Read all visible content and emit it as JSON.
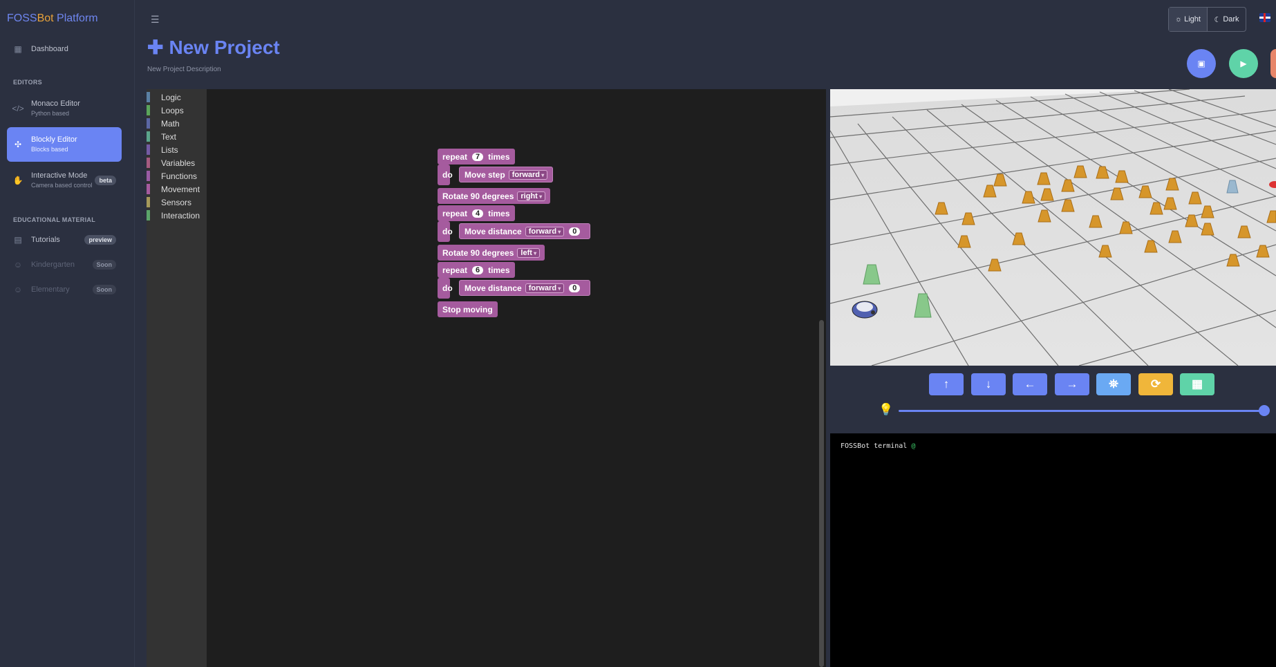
{
  "brand": {
    "part1": "FOSS",
    "part2": "Bot",
    "part3": " Platform"
  },
  "sidebar": {
    "dashboard": "Dashboard",
    "section_editors": "EDITORS",
    "editors": [
      {
        "label": "Monaco Editor",
        "sub": "Python based"
      },
      {
        "label": "Blockly Editor",
        "sub": "Blocks based"
      },
      {
        "label": "Interactive Mode",
        "sub": "Camera based control",
        "badge": "beta"
      }
    ],
    "section_edu": "EDUCATIONAL MATERIAL",
    "edu": [
      {
        "label": "Tutorials",
        "badge": "preview"
      },
      {
        "label": "Kindergarten",
        "badge": "Soon"
      },
      {
        "label": "Elementary",
        "badge": "Soon"
      }
    ]
  },
  "header": {
    "theme_light": "Light",
    "theme_dark": "Dark"
  },
  "project": {
    "title": "New Project",
    "description": "New Project Description"
  },
  "toolbox": [
    {
      "label": "Logic",
      "color": "#5b80a5"
    },
    {
      "label": "Loops",
      "color": "#5ba55b"
    },
    {
      "label": "Math",
      "color": "#5b67a5"
    },
    {
      "label": "Text",
      "color": "#5ba58c"
    },
    {
      "label": "Lists",
      "color": "#745ba5"
    },
    {
      "label": "Variables",
      "color": "#a55b80"
    },
    {
      "label": "Functions",
      "color": "#995ba5"
    },
    {
      "label": "Movement",
      "color": "#a55b9e"
    },
    {
      "label": "Sensors",
      "color": "#a5995b"
    },
    {
      "label": "Interaction",
      "color": "#5ba56a"
    }
  ],
  "blocks": {
    "repeat": "repeat",
    "times": "times",
    "do": "do",
    "n1": "7",
    "move_step": "Move step",
    "dir1": "forward",
    "rotate1": "Rotate 90 degrees",
    "rot_dir1": "right",
    "n2": "4",
    "move_distance": "Move distance",
    "dir2": "forward",
    "dist2": "0",
    "rotate2": "Rotate 90 degrees",
    "rot_dir2": "left",
    "n3": "6",
    "dir3": "forward",
    "dist3": "0",
    "stop": "Stop moving"
  },
  "controls": [
    {
      "icon": "arrow-up-icon",
      "glyph": "↑",
      "color": "#6a84f3"
    },
    {
      "icon": "arrow-down-icon",
      "glyph": "↓",
      "color": "#6a84f3"
    },
    {
      "icon": "arrow-left-icon",
      "glyph": "←",
      "color": "#6a84f3"
    },
    {
      "icon": "arrow-right-icon",
      "glyph": "→",
      "color": "#6a84f3"
    },
    {
      "icon": "binoculars-icon",
      "glyph": "⛯",
      "color": "#6aa9f3"
    },
    {
      "icon": "refresh-icon",
      "glyph": "⟳",
      "color": "#f0b63a"
    },
    {
      "icon": "map-icon",
      "glyph": "▦",
      "color": "#5fd3a8"
    }
  ],
  "terminal": {
    "text": "FOSSBot terminal",
    "prompt": "@"
  }
}
